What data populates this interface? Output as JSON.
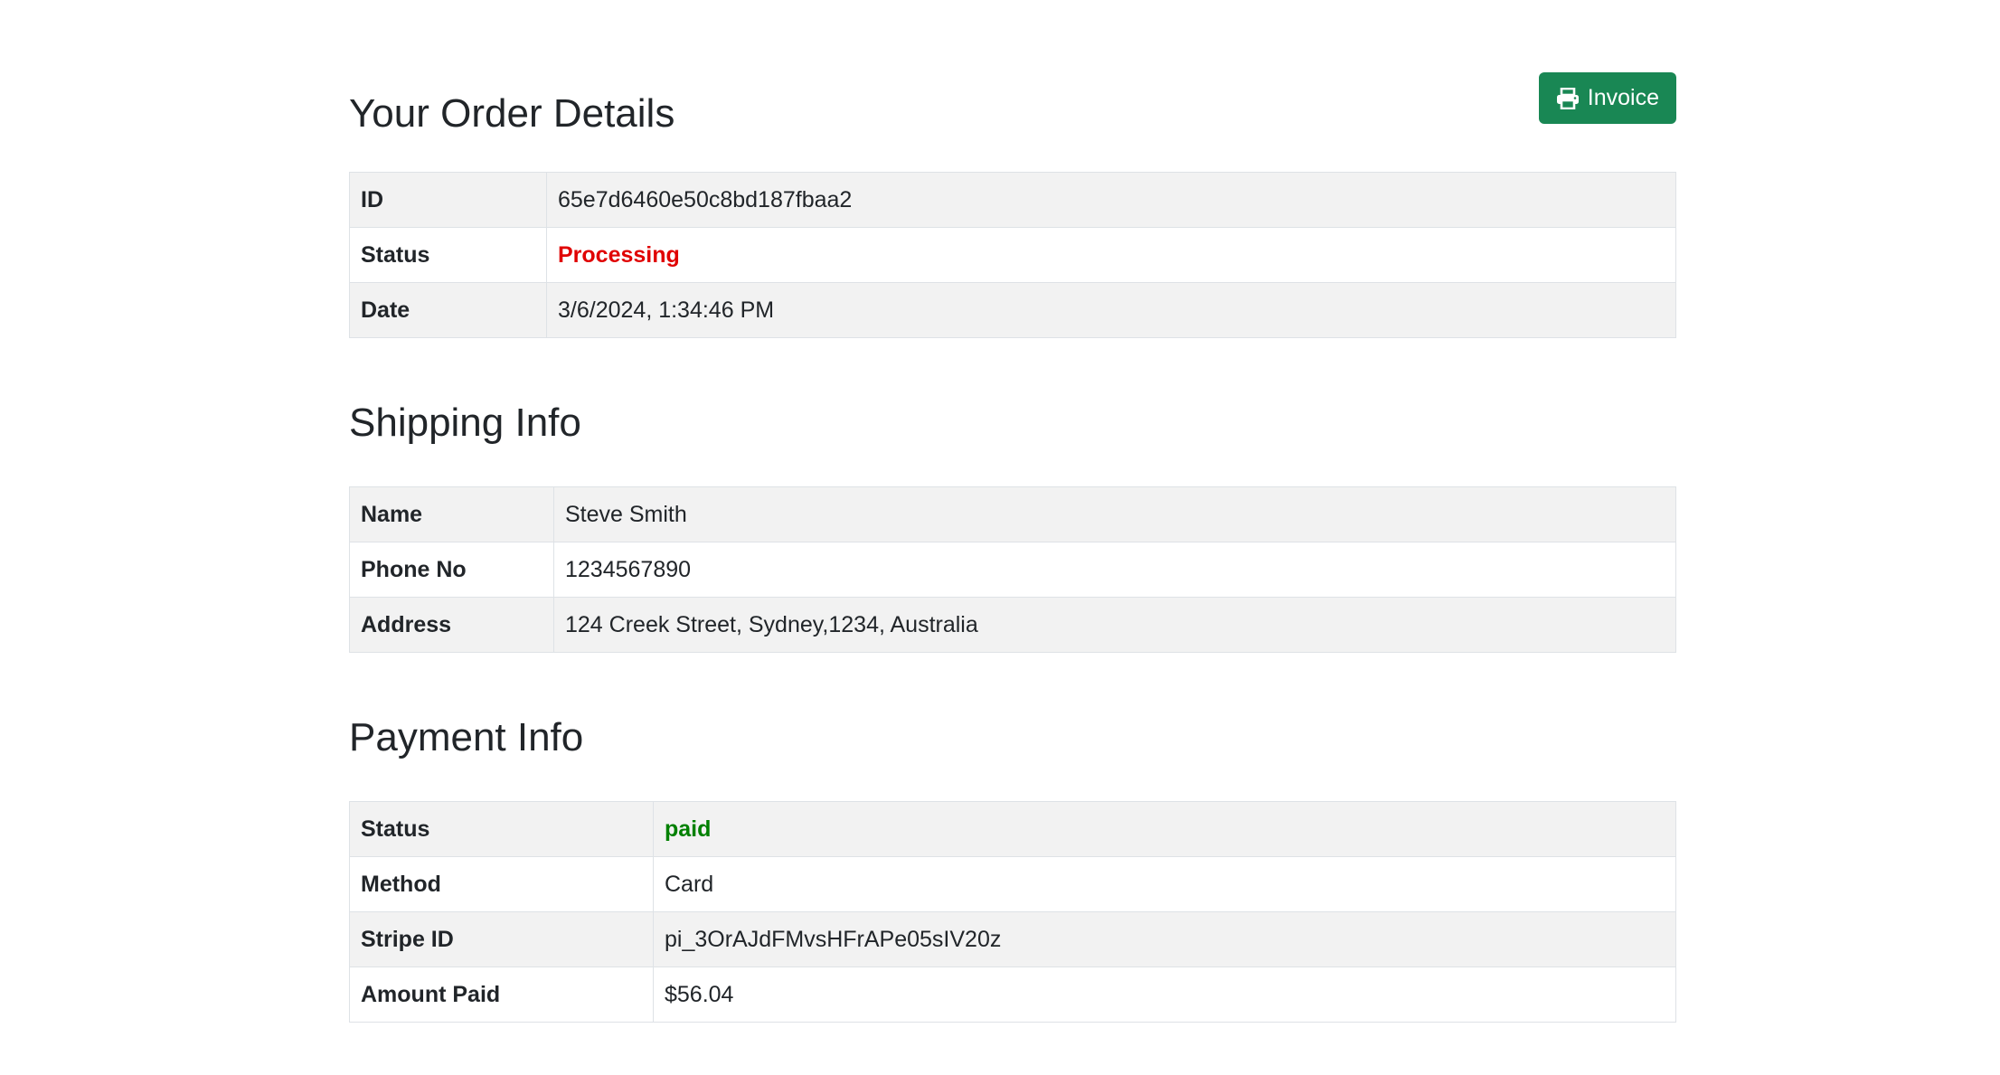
{
  "order": {
    "title": "Your Order Details",
    "invoice_label": "Invoice",
    "rows": [
      {
        "label": "ID",
        "value": "65e7d6460e50c8bd187fbaa2"
      },
      {
        "label": "Status",
        "value": "Processing"
      },
      {
        "label": "Date",
        "value": "3/6/2024, 1:34:46 PM"
      }
    ]
  },
  "shipping": {
    "title": "Shipping Info",
    "rows": [
      {
        "label": "Name",
        "value": "Steve Smith"
      },
      {
        "label": "Phone No",
        "value": "1234567890"
      },
      {
        "label": "Address",
        "value": "124 Creek Street, Sydney,1234, Australia"
      }
    ]
  },
  "payment": {
    "title": "Payment Info",
    "rows": [
      {
        "label": "Status",
        "value": "paid"
      },
      {
        "label": "Method",
        "value": "Card"
      },
      {
        "label": "Stripe ID",
        "value": "pi_3OrAJdFMvsHFrAPe05sIV20z"
      },
      {
        "label": "Amount Paid",
        "value": "$56.04"
      }
    ]
  },
  "colors": {
    "invoice_button": "#198754",
    "status_processing": "#e00000",
    "status_paid": "#008000",
    "row_striped": "#f2f2f2"
  },
  "icons": {
    "invoice_button": "printer-icon"
  }
}
